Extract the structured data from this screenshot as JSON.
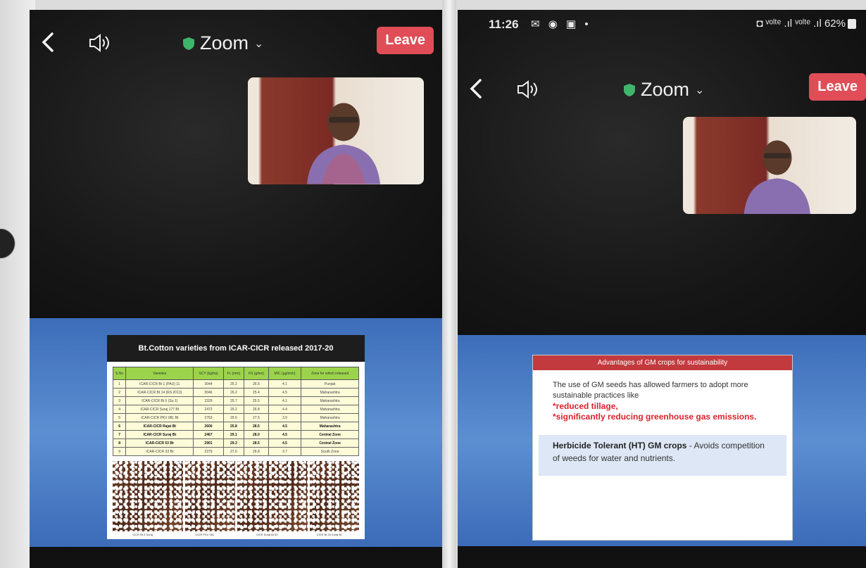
{
  "left_phone": {
    "meeting_title": "Zoom",
    "leave_label": "Leave",
    "slide": {
      "title": "Bt.Cotton varieties from ICAR-CICR released  2017-20",
      "columns": [
        "S.No",
        "Varieties",
        "SCY (kg/ha)",
        "FL (mm)",
        "FS (g/tex)",
        "MIC (µg/inch)",
        "Zone for which released"
      ],
      "rows": [
        [
          "1",
          "ICAR-CICR Bt 1 (PAU) 11",
          "3044",
          "25.2",
          "26.5",
          "4.1",
          "Punjab"
        ],
        [
          "2",
          "ICAR-CICR Bt 14 (RS 2013)",
          "3046",
          "26.2",
          "25.4",
          "4.5",
          "Maharashtra"
        ],
        [
          "3",
          "ICAR-CICR Bt 5 (Su 1)",
          "2329",
          "25.7",
          "25.5",
          "4.1",
          "Maharashtra"
        ],
        [
          "4",
          "ICAR-CICR Suraj 177 Bt",
          "2472",
          "29.2",
          "26.8",
          "4.4",
          "Maharashtra"
        ],
        [
          "5",
          "ICAR-CICR PKV 081 Bt",
          "2763",
          "29.5",
          "27.5",
          "3.9",
          "Maharashtra"
        ],
        [
          "6",
          "ICAR-CICR Rajat Bt",
          "2600",
          "25.8",
          "28.5",
          "4.5",
          "Maharashtra"
        ],
        [
          "7",
          "ICAR-CICR Suraj Bt",
          "2467",
          "29.1",
          "28.0",
          "4.5",
          "Central Zone"
        ],
        [
          "8",
          "ICAR-CICR 53 Bt",
          "2901",
          "29.3",
          "28.5",
          "4.5",
          "Central Zone"
        ],
        [
          "9",
          "ICAR-CICR 33 Bt",
          "2379",
          "27.6",
          "26.8",
          "3.7",
          "South Zone"
        ]
      ],
      "highlight_rows": [
        5,
        6,
        7
      ],
      "captions": [
        "CICR Bt 5 Suraj",
        "CICR PKV 081",
        "CICR Suraj Bt 53",
        "CICR Bt 33 Suraj Bt"
      ]
    }
  },
  "right_phone": {
    "status_time": "11:26",
    "status_icons": "✉ ◉ ▣ •",
    "status_right": "◘ ᵛᵒˡᵗᵉ .ıl ᵛᵒˡᵗᵉ .ıl 62%",
    "meeting_title": "Zoom",
    "leave_label": "Leave",
    "slide": {
      "title": "Advantages of GM crops for sustainability",
      "intro": "The use of GM seeds has allowed farmers to adopt more sustainable practices like",
      "point1": "*reduced tillage,",
      "point2": "*significantly reducing greenhouse gas emissions.",
      "ht_heading": "Herbicide Tolerant (HT) GM crops",
      "ht_text": " - Avoids competition of weeds for  water and nutrients."
    }
  },
  "colors": {
    "leave": "#e04d57",
    "shield": "#3fb46b",
    "slide_bg": "#4a7cc4",
    "gm_title_bar": "#c23a3e",
    "table_header": "#9bd44a"
  }
}
